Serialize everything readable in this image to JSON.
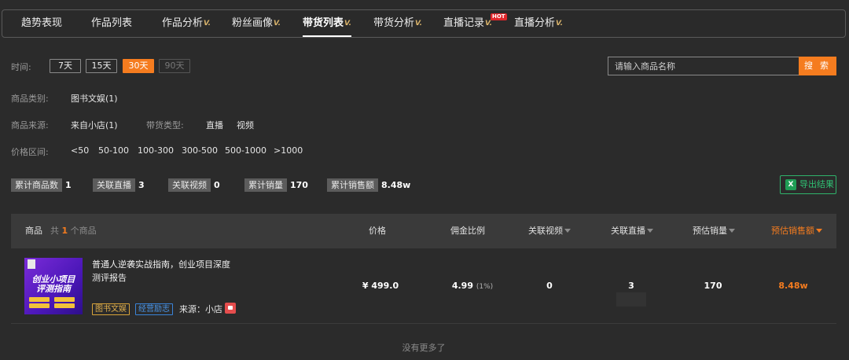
{
  "tabs": [
    {
      "label": "趋势表现",
      "vip": false
    },
    {
      "label": "作品列表",
      "vip": false
    },
    {
      "label": "作品分析",
      "vip": true
    },
    {
      "label": "粉丝画像",
      "vip": true
    },
    {
      "label": "带货列表",
      "vip": true,
      "active": true
    },
    {
      "label": "带货分析",
      "vip": true
    },
    {
      "label": "直播记录",
      "vip": true,
      "badge": "HOT"
    },
    {
      "label": "直播分析",
      "vip": true
    }
  ],
  "vip_mark": "V.",
  "filters": {
    "time_label": "时间:",
    "time_options": [
      "7天",
      "15天",
      "30天",
      "90天"
    ],
    "time_selected": "30天",
    "category_label": "商品类别:",
    "category_value": "图书文娱(1)",
    "source_label": "商品来源:",
    "source_value": "来自小店(1)",
    "sell_type_label": "带货类型:",
    "sell_type_options": [
      "直播",
      "视频"
    ],
    "price_label": "价格区间:",
    "price_options": [
      "<50",
      "50-100",
      "100-300",
      "300-500",
      "500-1000",
      ">1000"
    ]
  },
  "search": {
    "placeholder": "请输入商品名称",
    "button": "搜 索"
  },
  "stats": [
    {
      "label": "累计商品数",
      "value": "1"
    },
    {
      "label": "关联直播",
      "value": "3"
    },
    {
      "label": "关联视频",
      "value": "0"
    },
    {
      "label": "累计销量",
      "value": "170"
    },
    {
      "label": "累计销售额",
      "value": "8.48w"
    }
  ],
  "export_label": "导出结果",
  "export_icon": "excel-icon",
  "table": {
    "headers": {
      "product": "商品",
      "count_prefix": "共",
      "count": "1",
      "count_suffix": "个商品",
      "price": "价格",
      "commission": "佣金比例",
      "videos": "关联视频",
      "lives": "关联直播",
      "sales": "预估销量",
      "revenue": "预估销售额"
    },
    "rows": [
      {
        "thumb_text": "创业小项目 评测指南",
        "name": "普通人逆袭实战指南，创业项目深度测评报告",
        "category_tag": "图书文娱",
        "biz_tag": "经营励志",
        "source": "来源：小店",
        "price": "¥ 499.0",
        "commission": "4.99",
        "commission_pct": "(1%)",
        "videos": "0",
        "lives": "3",
        "sales": "170",
        "revenue": "8.48w"
      }
    ],
    "footer": "没有更多了"
  },
  "colors": {
    "accent": "#f57c1f",
    "export_green": "#2fc073",
    "hot": "#e0262b",
    "tag_yellow": "#e2b04c",
    "tag_blue": "#4a96ea"
  }
}
